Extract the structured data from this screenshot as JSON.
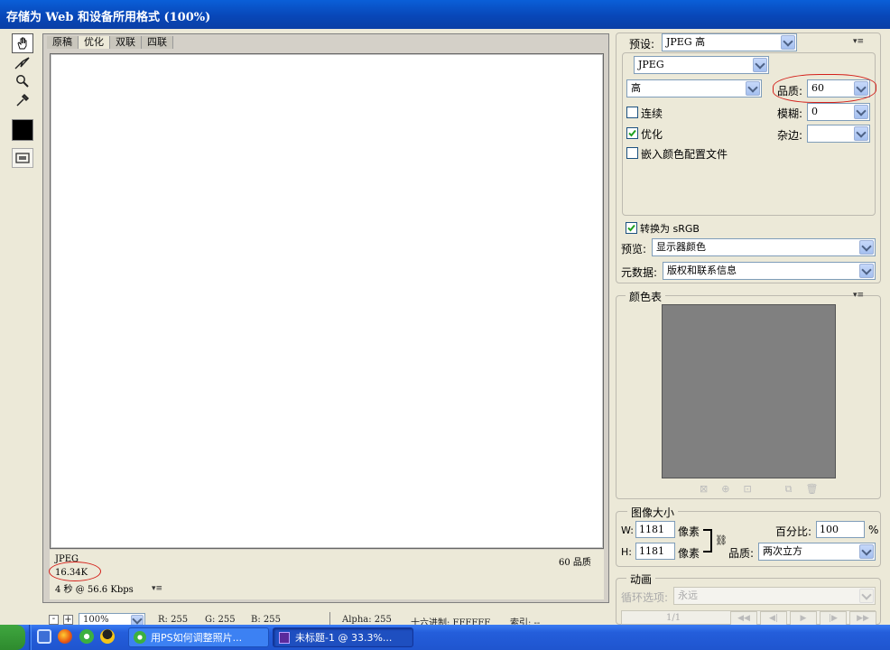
{
  "window": {
    "title": "存储为 Web 和设备所用格式 (100%)"
  },
  "tools": [
    {
      "name": "hand-tool-icon",
      "glyph": "✋"
    },
    {
      "name": "slice-select-tool-icon",
      "glyph": "↗"
    },
    {
      "name": "zoom-tool-icon",
      "glyph": "🔍"
    },
    {
      "name": "eyedropper-tool-icon",
      "glyph": "✎"
    }
  ],
  "tabs": [
    "原稿",
    "优化",
    "双联",
    "四联"
  ],
  "active_tab": "优化",
  "preview": {
    "format": "JPEG",
    "size": "16.34K",
    "time": "4 秒 @ 56.6 Kbps",
    "quality_label": "60 品质"
  },
  "settings": {
    "preset_label": "预设:",
    "preset_value": "JPEG 高",
    "format_value": "JPEG",
    "compression_value": "高",
    "quality_label": "品质:",
    "quality_value": "60",
    "blur_label": "模糊:",
    "blur_value": "0",
    "matte_label": "杂边:",
    "matte_value": "",
    "progressive_label": "连续",
    "optimized_label": "优化",
    "embed_profile_label": "嵌入颜色配置文件",
    "convert_srgb_label": "转换为 sRGB",
    "preview_label": "预览:",
    "preview_value": "显示器颜色",
    "metadata_label": "元数据:",
    "metadata_value": "版权和联系信息"
  },
  "color_table": {
    "title": "颜色表"
  },
  "image_size": {
    "title": "图像大小",
    "w_label": "W:",
    "w_value": "1181",
    "h_label": "H:",
    "h_value": "1181",
    "unit": "像素",
    "percent_label": "百分比:",
    "percent_value": "100",
    "percent_unit": "%",
    "quality_label": "品质:",
    "quality_value": "两次立方"
  },
  "animation": {
    "title": "动画",
    "loop_label": "循环选项:",
    "loop_value": "永远",
    "frame_counter": "1/1"
  },
  "status": {
    "zoom": "100%",
    "r": "R: 255",
    "g": "G: 255",
    "b": "B: 255",
    "alpha": "Alpha: 255",
    "hex": "十六进制: FFFFFF",
    "index": "索引: --"
  },
  "taskbar": {
    "tasks": [
      "用PS如何调整照片...",
      "未标题-1 @ 33.3%..."
    ]
  },
  "colors": {
    "title_bar": "#0a4fc6",
    "annotation_red": "#d4201a",
    "swatch": "#000000",
    "color_table_fill": "#808080"
  }
}
